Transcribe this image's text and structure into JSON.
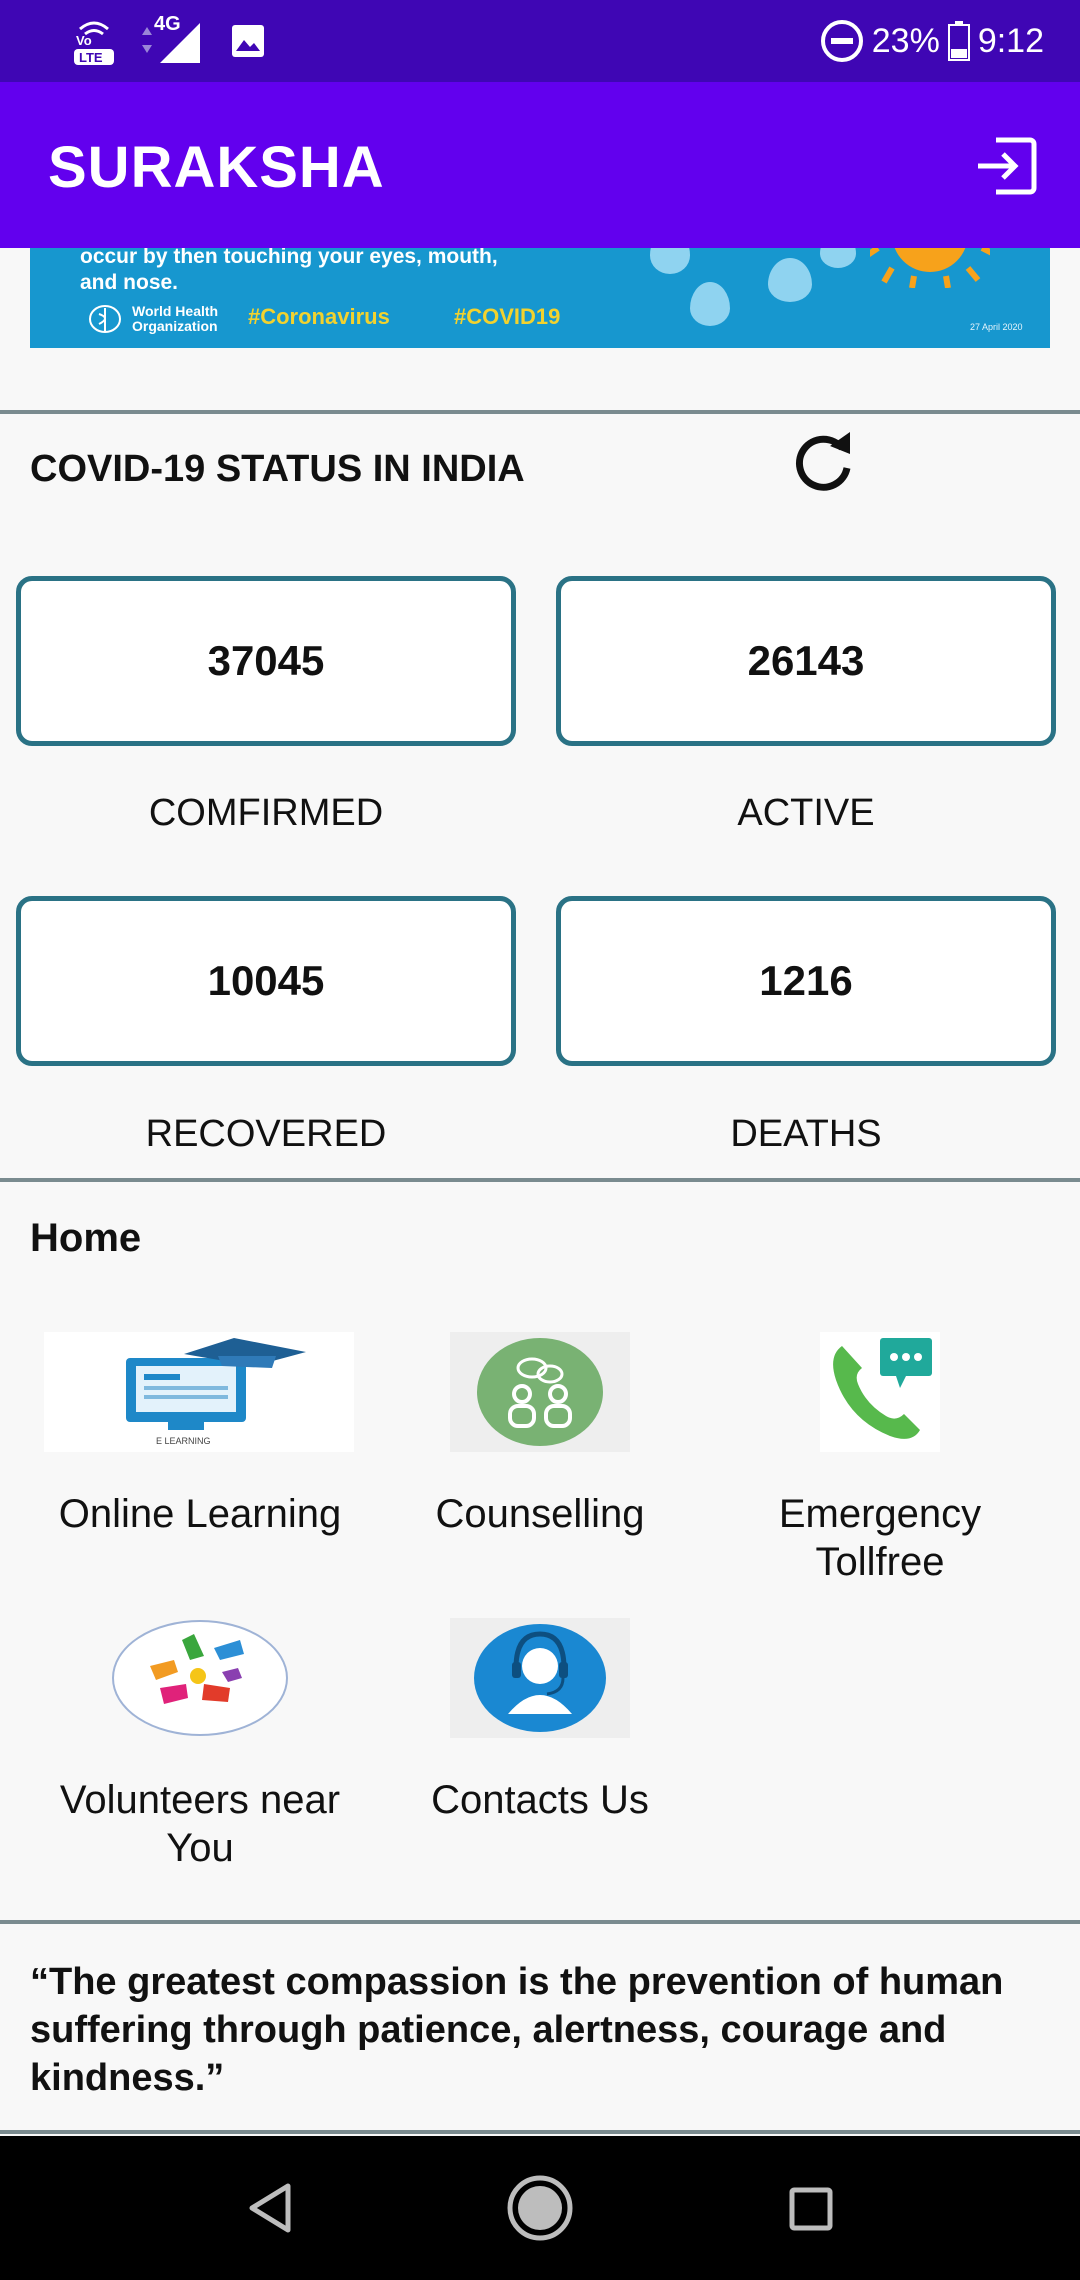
{
  "status_bar": {
    "battery": "23%",
    "time": "9:12",
    "network": "4G",
    "icons": [
      "volte-icon",
      "signal-icon",
      "image-icon",
      "dnd-icon",
      "battery-icon"
    ]
  },
  "app_bar": {
    "title": "SURAKSHA",
    "logout_icon": "logout-icon"
  },
  "banner": {
    "text_lines": [
      "occur by then touching your eyes, mouth,",
      "and nose."
    ],
    "org": [
      "World Health",
      "Organization"
    ],
    "hashtags": [
      "#Coronavirus",
      "#COVID19"
    ],
    "date": "27 April 2020"
  },
  "covid": {
    "title": "COVID-19 STATUS IN INDIA",
    "refresh_icon": "refresh-icon",
    "stats": [
      {
        "value": "37045",
        "label": "COMFIRMED"
      },
      {
        "value": "26143",
        "label": "ACTIVE"
      },
      {
        "value": "10045",
        "label": "RECOVERED"
      },
      {
        "value": "1216",
        "label": "DEATHS"
      }
    ]
  },
  "home": {
    "title": "Home",
    "tiles": [
      {
        "label": "Online Learning",
        "image_caption": "E LEARNING",
        "icon": "e-learning-icon"
      },
      {
        "label": "Counselling",
        "icon": "counselling-icon"
      },
      {
        "label": "Emergency Tollfree",
        "icon": "phone-chat-icon"
      },
      {
        "label": "Volunteers near You",
        "icon": "hands-icon"
      },
      {
        "label": "Contacts Us",
        "icon": "support-agent-icon"
      }
    ]
  },
  "quote": "“The greatest compassion is the prevention of human suffering through patience, alertness, courage and kindness.”",
  "colors": {
    "status_bar": "#3f06b4",
    "app_bar": "#6200ee",
    "stat_border": "#2a7285",
    "divider": "#7a8b8f",
    "banner": "#1797cf"
  }
}
